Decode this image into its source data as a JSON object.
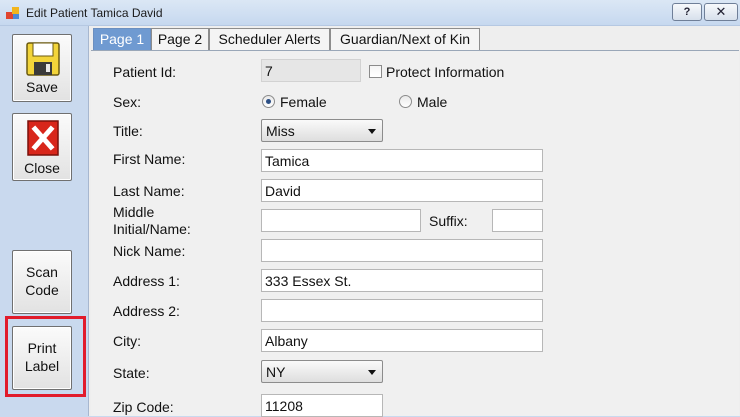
{
  "window": {
    "title": "Edit Patient Tamica David",
    "help_label": "?",
    "close_label": "✕"
  },
  "toolbar": {
    "save_label": "Save",
    "close_label": "Close",
    "scan_label_line1": "Scan",
    "scan_label_line2": "Code",
    "print_label_line1": "Print",
    "print_label_line2": "Label",
    "highlight_color": "#e11b2b"
  },
  "tabs": [
    {
      "label": "Page 1",
      "active": true
    },
    {
      "label": "Page 2",
      "active": false
    },
    {
      "label": "Scheduler Alerts",
      "active": false
    },
    {
      "label": "Guardian/Next of Kin",
      "active": false
    }
  ],
  "form": {
    "patient_id_label": "Patient Id:",
    "patient_id_value": "7",
    "protect_label": "Protect Information",
    "sex_label": "Sex:",
    "sex_female": "Female",
    "sex_male": "Male",
    "sex_selected": "Female",
    "title_label": "Title:",
    "title_value": "Miss",
    "first_name_label": "First Name:",
    "first_name_value": "Tamica",
    "last_name_label": "Last Name:",
    "last_name_value": "David",
    "middle_label_line1": "Middle",
    "middle_label_line2": "Initial/Name:",
    "middle_value": "",
    "suffix_label": "Suffix:",
    "suffix_value": "",
    "nick_label": "Nick Name:",
    "nick_value": "",
    "address1_label": "Address 1:",
    "address1_value": "333 Essex St.",
    "address2_label": "Address 2:",
    "address2_value": "",
    "city_label": "City:",
    "city_value": "Albany",
    "state_label": "State:",
    "state_value": "NY",
    "zip_label": "Zip Code:",
    "zip_value": "11208"
  }
}
